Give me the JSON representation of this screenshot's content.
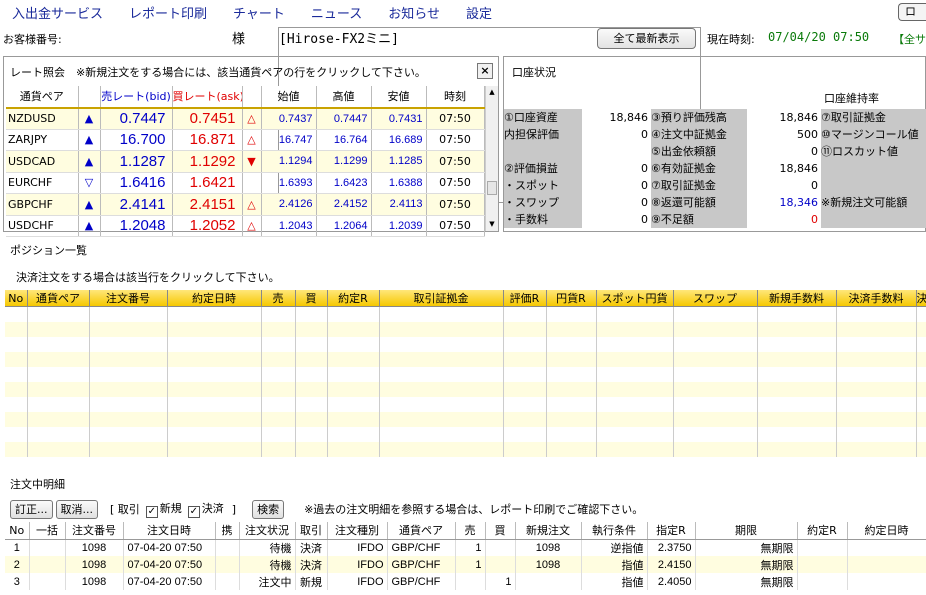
{
  "menu": [
    "入出金サービス",
    "レポート印刷",
    "チャート",
    "ニュース",
    "お知らせ",
    "設定"
  ],
  "menu_right_button": "ロ",
  "customer": {
    "label": "お客様番号:",
    "sama": "様",
    "account": "[Hirose-FX2ミニ]"
  },
  "refresh_button": "全て最新表示",
  "time": {
    "label": "現在時刻:",
    "value": "07/04/20 07:50",
    "extra": "【全サ"
  },
  "rate_panel": {
    "title": "レート照会　※新規注文をする場合には、該当通貨ペアの行をクリックして下さい。",
    "close": "×",
    "headers": [
      "通貨ペア",
      "",
      "売レート(bid)",
      "買レート(ask)",
      "",
      "始値",
      "高値",
      "安値",
      "時刻"
    ],
    "rows": [
      {
        "pair": "NZDUSD",
        "bid_icon": "▲",
        "bid": "0.7447",
        "ask": "0.7451",
        "ask_icon": "△",
        "open": "0.7437",
        "high": "0.7447",
        "low": "0.7431",
        "time": "07:50"
      },
      {
        "pair": "ZARJPY",
        "bid_icon": "▲",
        "bid": "16.700",
        "ask": "16.871",
        "ask_icon": "△",
        "open": "16.747",
        "high": "16.764",
        "low": "16.689",
        "time": "07:50"
      },
      {
        "pair": "USDCAD",
        "bid_icon": "▲",
        "bid": "1.1287",
        "ask": "1.1292",
        "ask_icon": "▼",
        "open": "1.1294",
        "high": "1.1299",
        "low": "1.1285",
        "time": "07:50"
      },
      {
        "pair": "EURCHF",
        "bid_icon": "▽",
        "bid": "1.6416",
        "ask": "1.6421",
        "ask_icon": "",
        "open": "1.6393",
        "high": "1.6423",
        "low": "1.6388",
        "time": "07:50"
      },
      {
        "pair": "GBPCHF",
        "bid_icon": "▲",
        "bid": "2.4141",
        "ask": "2.4151",
        "ask_icon": "△",
        "open": "2.4126",
        "high": "2.4152",
        "low": "2.4113",
        "time": "07:50"
      },
      {
        "pair": "USDCHF",
        "bid_icon": "▲",
        "bid": "1.2048",
        "ask": "1.2052",
        "ask_icon": "△",
        "open": "1.2043",
        "high": "1.2064",
        "low": "1.2039",
        "time": "07:50"
      }
    ]
  },
  "account_panel": {
    "title": "口座状況",
    "maintenance_title": "口座維持率",
    "rows": [
      [
        "①口座資産",
        "18,846",
        "③預り評価残高",
        "18,846",
        "⑦取引証拠金"
      ],
      [
        "内担保評価",
        "0",
        "④注文中証拠金",
        "500",
        "⑩マージンコール値"
      ],
      [
        "",
        "",
        "⑤出金依頼額",
        "0",
        "⑪ロスカット値"
      ],
      [
        "②評価損益",
        "0",
        "⑥有効証拠金",
        "18,846",
        ""
      ],
      [
        "・スポット",
        "0",
        "⑦取引証拠金",
        "0",
        ""
      ],
      [
        "・スワップ",
        "0",
        "⑧返還可能額",
        "18,346",
        "※新規注文可能額"
      ],
      [
        "・手数料",
        "0",
        "⑨不足額",
        "0",
        ""
      ]
    ]
  },
  "positions": {
    "title": "ポジション一覧",
    "instruction": "決済注文をする場合は該当行をクリックして下さい。",
    "headers": [
      "No",
      "通貨ペア",
      "注文番号",
      "約定日時",
      "売",
      "買",
      "約定R",
      "取引証拠金",
      "評価R",
      "円貨R",
      "スポット円貨",
      "スワップ",
      "新規手数料",
      "決済手数料",
      "決"
    ]
  },
  "orders": {
    "title": "注文中明細",
    "correct_button": "訂正...",
    "cancel_button": "取消...",
    "filter_label": "[ 取引",
    "filter_new": "新規",
    "filter_settle": "決済",
    "filter_end": "]",
    "search_button": "検索",
    "note": "※過去の注文明細を参照する場合は、レポート印刷でご確認下さい。",
    "headers": [
      "No",
      "一括",
      "注文番号",
      "注文日時",
      "携",
      "注文状況",
      "取引",
      "注文種別",
      "通貨ペア",
      "売",
      "買",
      "新規注文",
      "執行条件",
      "指定R",
      "期限",
      "約定R",
      "約定日時"
    ],
    "rows": [
      [
        "1",
        "",
        "1098",
        "07-04-20 07:50",
        "",
        "待機",
        "決済",
        "IFDO",
        "GBP/CHF",
        "1",
        "",
        "1098",
        "逆指値",
        "2.3750",
        "無期限",
        "",
        ""
      ],
      [
        "2",
        "",
        "1098",
        "07-04-20 07:50",
        "",
        "待機",
        "決済",
        "IFDO",
        "GBP/CHF",
        "1",
        "",
        "1098",
        "指値",
        "2.4150",
        "無期限",
        "",
        ""
      ],
      [
        "3",
        "",
        "1098",
        "07-04-20 07:50",
        "",
        "注文中",
        "新規",
        "IFDO",
        "GBP/CHF",
        "",
        "1",
        "",
        "指値",
        "2.4050",
        "無期限",
        "",
        ""
      ]
    ]
  },
  "colors": {
    "bid": "#0000c8",
    "ask": "#e00000",
    "time": "#0a7a0a",
    "header_gold": "#f6c800",
    "row_alt": "#fffde0"
  }
}
